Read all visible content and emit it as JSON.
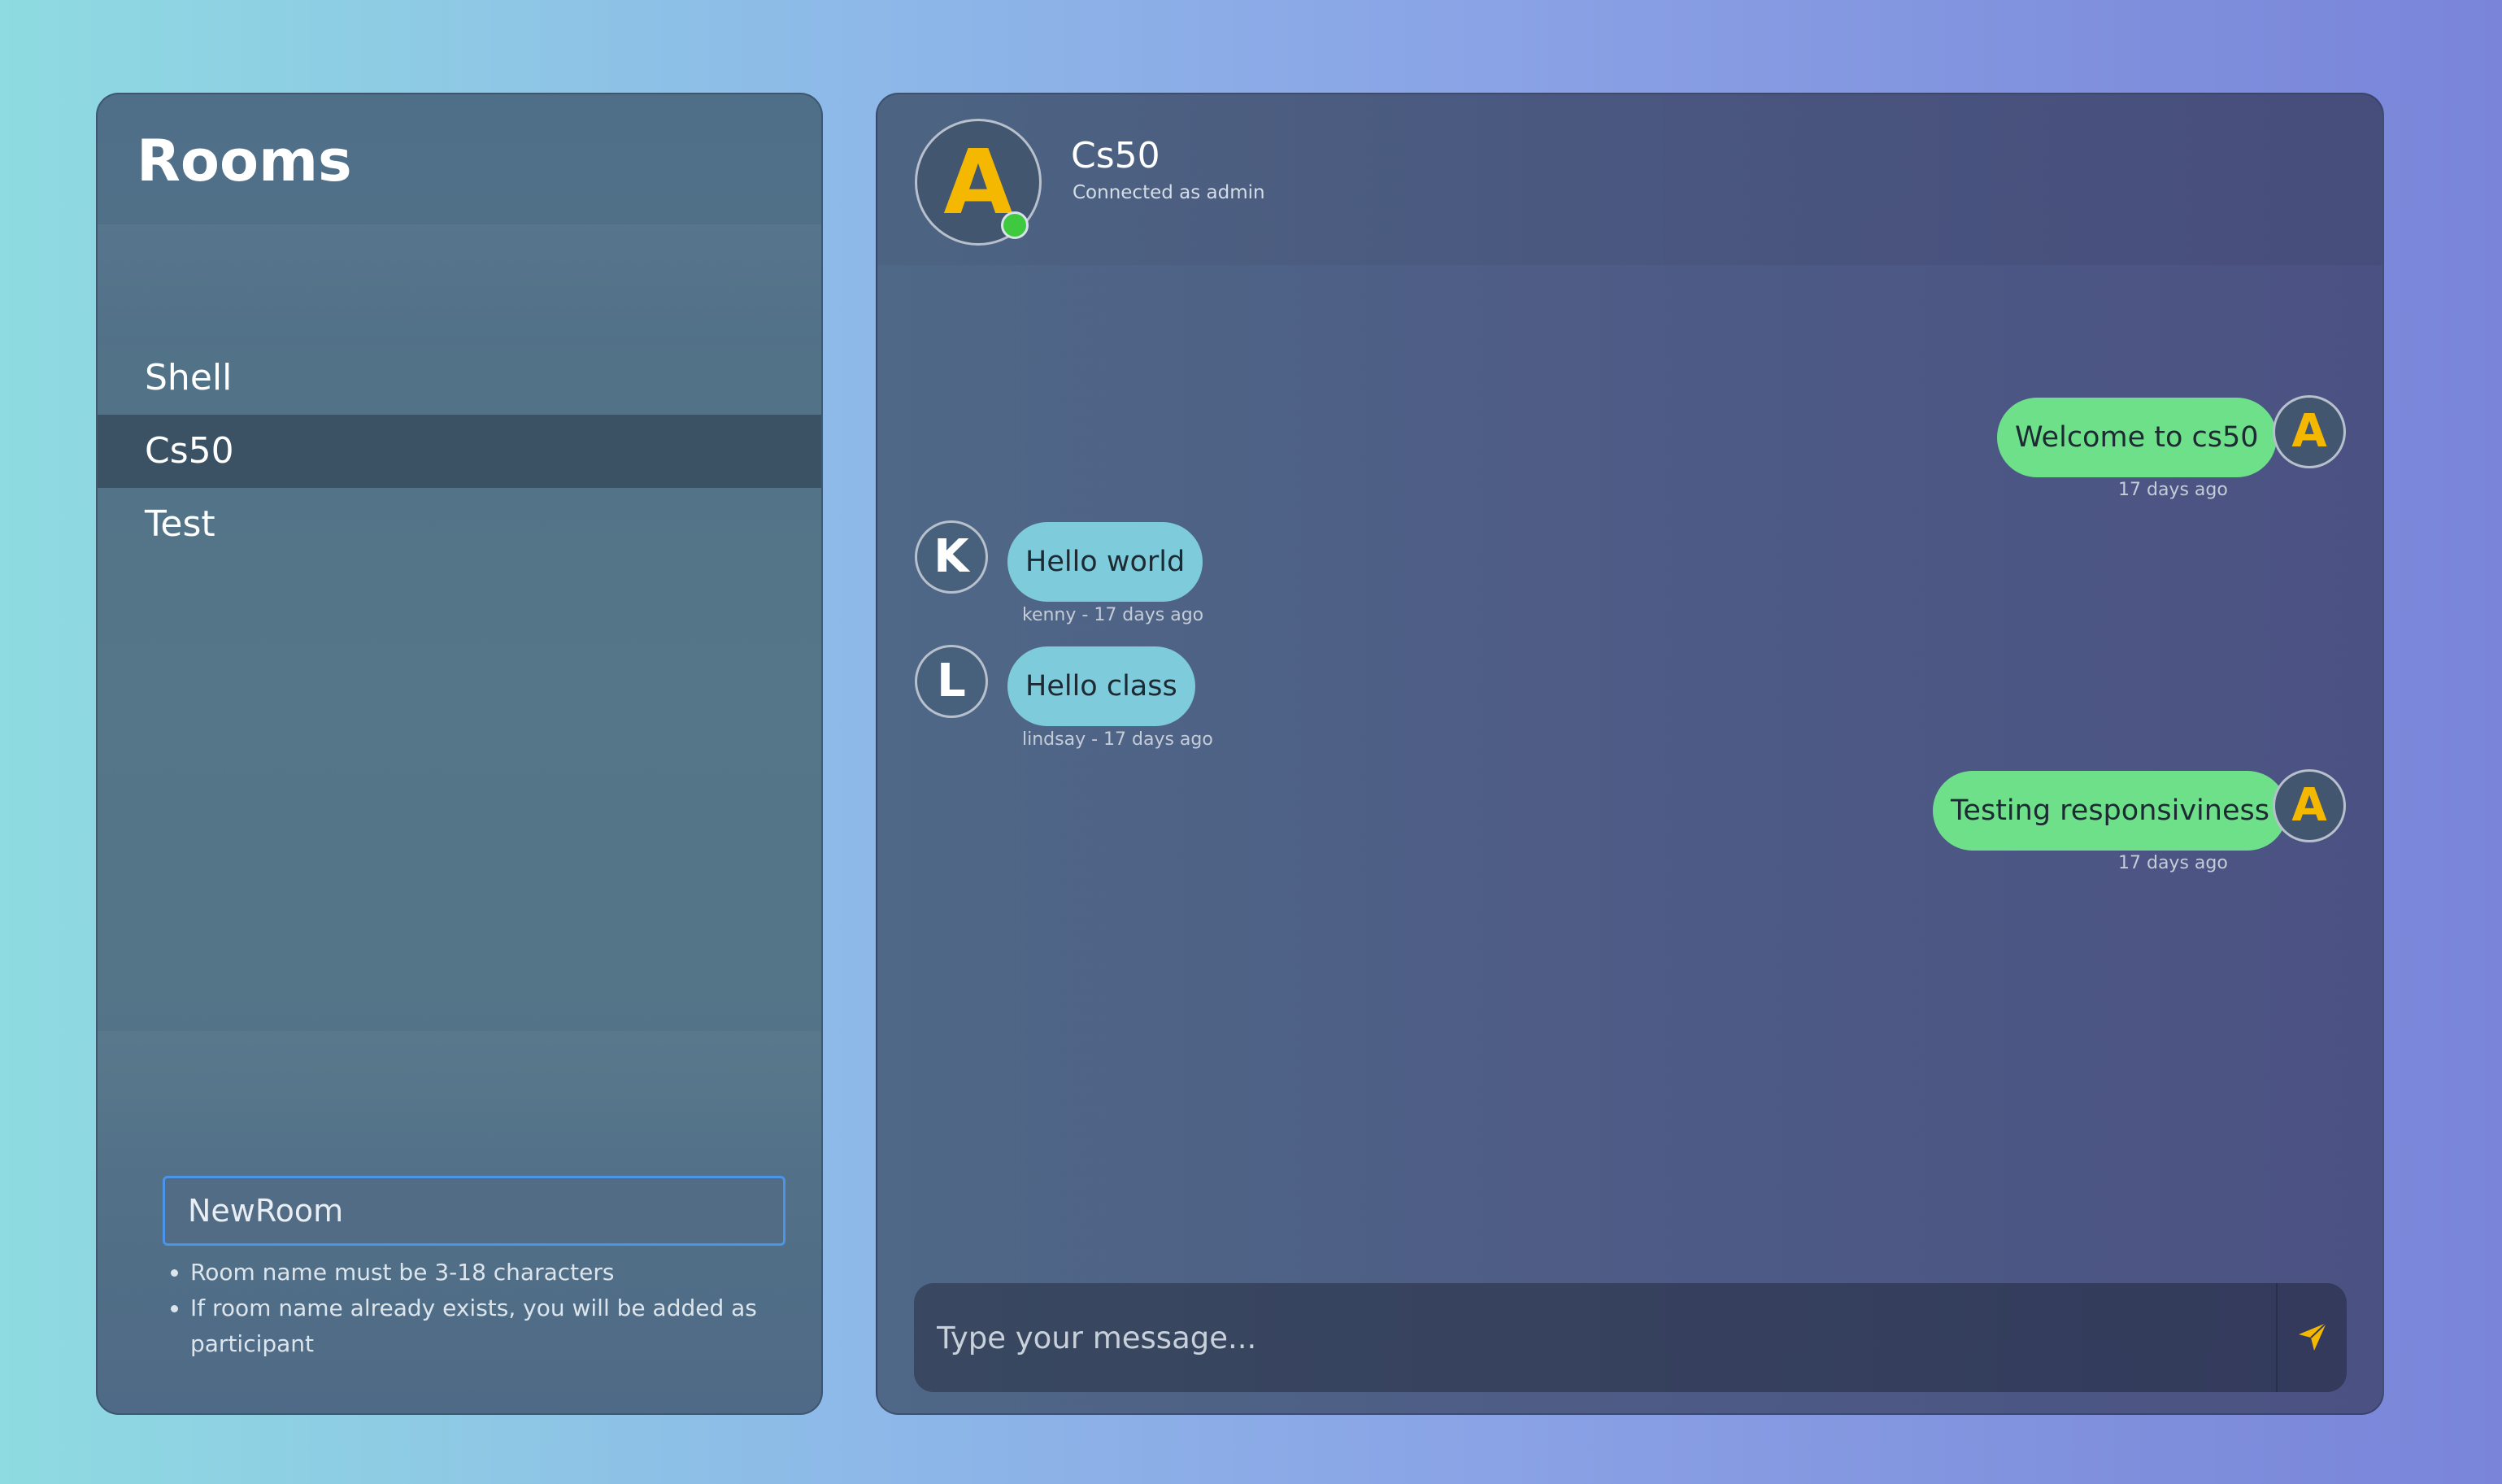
{
  "rooms": {
    "title": "Rooms",
    "items": [
      {
        "label": "Shell",
        "active": false
      },
      {
        "label": "Cs50",
        "active": true
      },
      {
        "label": "Test",
        "active": false
      }
    ],
    "create": {
      "input_value": "NewRoom",
      "hints": [
        "Room name must be 3-18 characters",
        "If room name already exists, you will be added as participant"
      ],
      "cancel_icon": "x-icon",
      "confirm_icon": "check-icon"
    }
  },
  "chat": {
    "header": {
      "avatar_letter": "A",
      "title": "Cs50",
      "subtitle": "Connected as admin",
      "status": "online"
    },
    "messages": [
      {
        "own": true,
        "avatar": "A",
        "text": "Welcome to cs50",
        "meta": "17 days ago"
      },
      {
        "own": false,
        "avatar": "K",
        "text": "Hello world",
        "meta": "kenny - 17 days ago"
      },
      {
        "own": false,
        "avatar": "L",
        "text": "Hello class",
        "meta": "lindsay - 17 days ago"
      },
      {
        "own": true,
        "avatar": "A",
        "text": "Testing responsiviness",
        "meta": "17 days ago"
      }
    ],
    "composer": {
      "placeholder": "Type your message...",
      "send_icon": "send-icon"
    }
  },
  "colors": {
    "accent": "#f5b800",
    "own_bubble": "#6fe08a",
    "other_bubble": "#7ecbdb",
    "active_room": "#3b5265",
    "online": "#3ec93e",
    "input_focus": "#4a95ea"
  }
}
